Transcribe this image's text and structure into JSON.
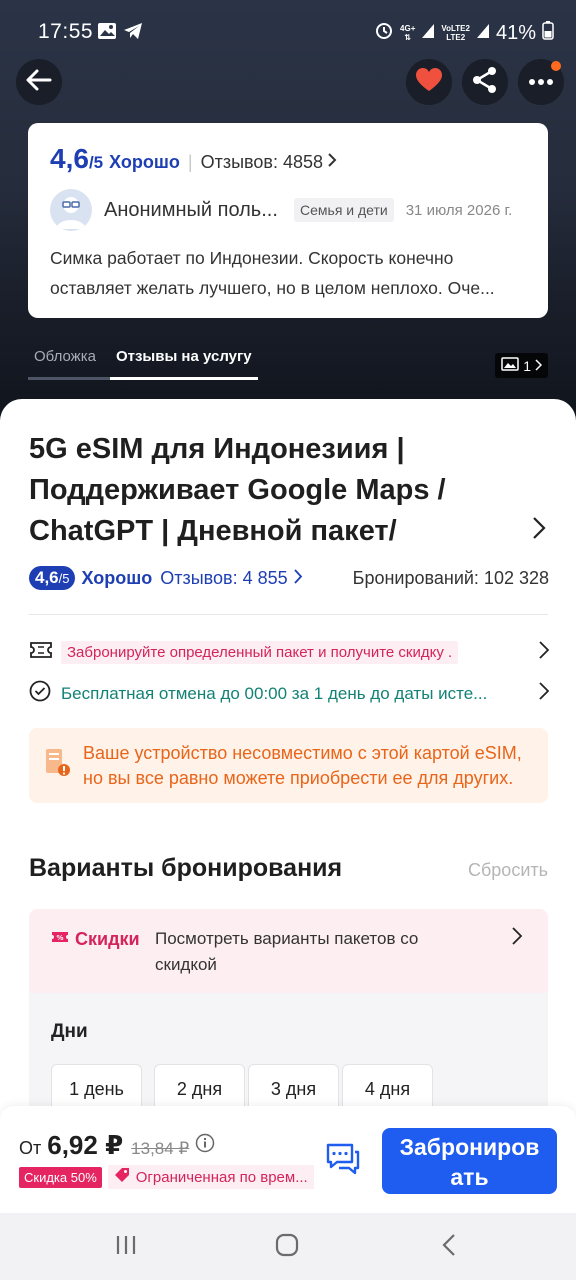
{
  "status_bar": {
    "time": "17:55",
    "battery": "41%",
    "net1": "4G+",
    "net2": "VoLTE2",
    "lte": "LTE2"
  },
  "review_card": {
    "score": "4,6",
    "out_of": "/5",
    "rating_word": "Хорошо",
    "reviews_count": "Отзывов: 4858",
    "user_name": "Анонимный поль...",
    "tag": "Семья и дети",
    "date": "31 июля 2026 г.",
    "text": "Симка работает по Индонезии. Скорость конечно оставляет желать лучшего, но в целом неплохо. Оче..."
  },
  "gallery_tabs": [
    "Обложка",
    "Отзывы на услугу"
  ],
  "photo_count": "1",
  "product": {
    "title": "5G eSIM для Индонезиия | Поддерживает Google Maps / ChatGPT | Дневной пакет/Полный",
    "score": "4,6",
    "out_of": "/5",
    "rating_word": "Хорошо",
    "reviews_link": "Отзывов: 4 855",
    "bookings": "Бронирований: 102 328",
    "promo": "Забронируйте определенный пакет и получите скидку .",
    "cancel": "Бесплатная отмена до 00:00 за 1 день до даты исте...",
    "warning_line1": "Ваше устройство несовместимо с этой картой eSIM,",
    "warning_line2": "но вы все равно можете приобрести ее для других."
  },
  "booking": {
    "heading": "Варианты бронирования",
    "reset": "Сбросить",
    "discounts_label": "Скидки",
    "discounts_text": "Посмотреть варианты пакетов со скидкой",
    "days_title": "Дни",
    "days": [
      "1 день",
      "2 дня",
      "3 дня",
      "4 дня"
    ]
  },
  "bottom": {
    "from": "От",
    "price": "6,92 ₽",
    "old_price": "13,84 ₽",
    "sale_badge": "Скидка 50%",
    "limited": "Ограниченная по врем...",
    "book_line1": "Заброниров",
    "book_line2": "ать"
  },
  "colors": {
    "brand_blue": "#1e3fb4",
    "book_button": "#1f5cf0",
    "promo_pink": "#d4245c",
    "cancel_green": "#138275",
    "warning_orange": "#e8651a"
  }
}
